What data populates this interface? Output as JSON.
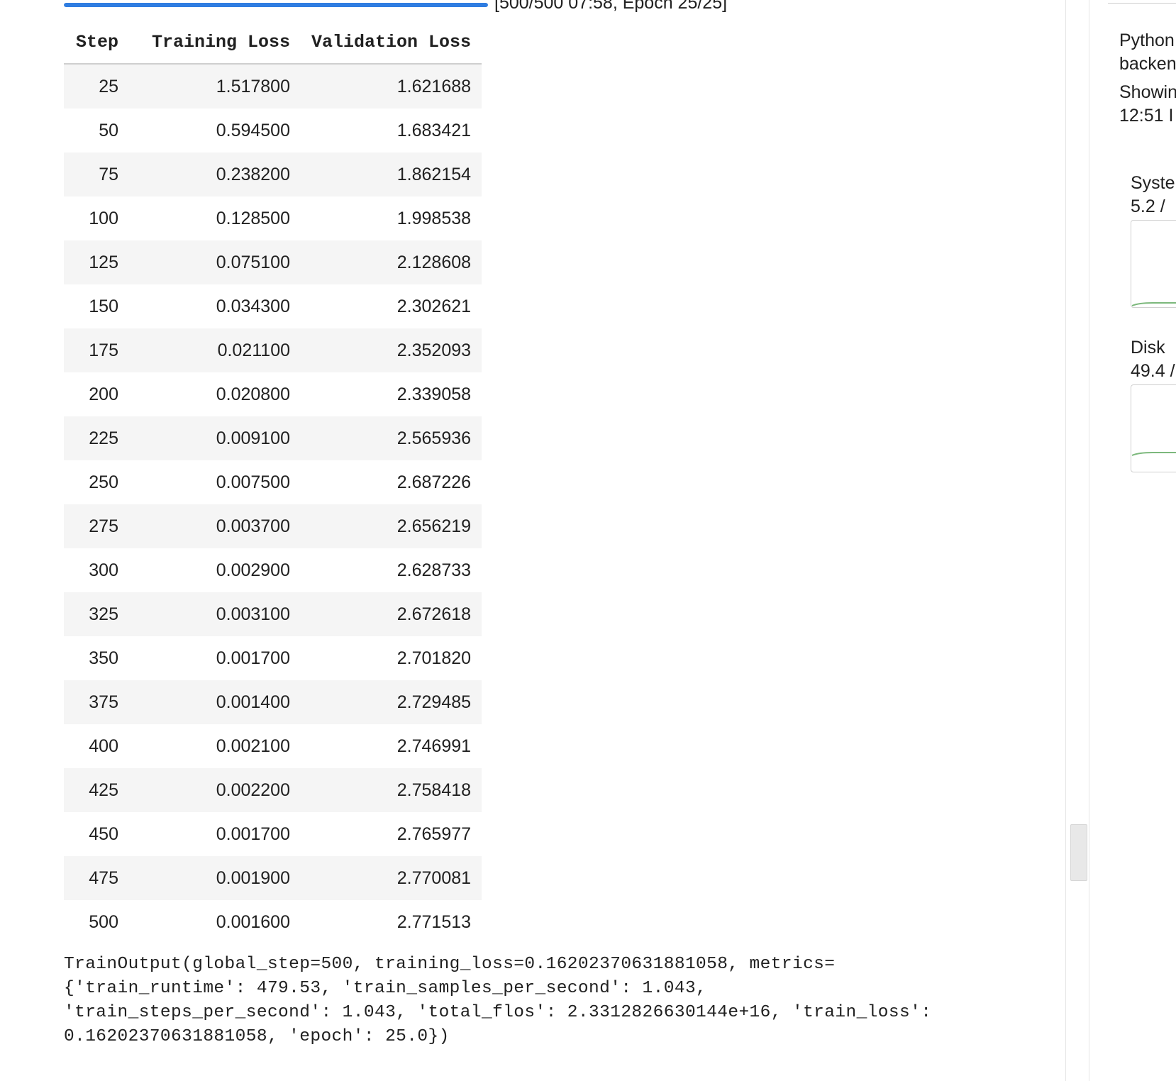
{
  "progress": {
    "fraction": 1.0,
    "label": "[500/500 07:58, Epoch 25/25]"
  },
  "table": {
    "columns": [
      "Step",
      "Training Loss",
      "Validation Loss"
    ],
    "rows": [
      [
        "25",
        "1.517800",
        "1.621688"
      ],
      [
        "50",
        "0.594500",
        "1.683421"
      ],
      [
        "75",
        "0.238200",
        "1.862154"
      ],
      [
        "100",
        "0.128500",
        "1.998538"
      ],
      [
        "125",
        "0.075100",
        "2.128608"
      ],
      [
        "150",
        "0.034300",
        "2.302621"
      ],
      [
        "175",
        "0.021100",
        "2.352093"
      ],
      [
        "200",
        "0.020800",
        "2.339058"
      ],
      [
        "225",
        "0.009100",
        "2.565936"
      ],
      [
        "250",
        "0.007500",
        "2.687226"
      ],
      [
        "275",
        "0.003700",
        "2.656219"
      ],
      [
        "300",
        "0.002900",
        "2.628733"
      ],
      [
        "325",
        "0.003100",
        "2.672618"
      ],
      [
        "350",
        "0.001700",
        "2.701820"
      ],
      [
        "375",
        "0.001400",
        "2.729485"
      ],
      [
        "400",
        "0.002100",
        "2.746991"
      ],
      [
        "425",
        "0.002200",
        "2.758418"
      ],
      [
        "450",
        "0.001700",
        "2.765977"
      ],
      [
        "475",
        "0.001900",
        "2.770081"
      ],
      [
        "500",
        "0.001600",
        "2.771513"
      ]
    ]
  },
  "train_output": "TrainOutput(global_step=500, training_loss=0.16202370631881058, metrics=\n{'train_runtime': 479.53, 'train_samples_per_second': 1.043,\n'train_steps_per_second': 1.043, 'total_flos': 2.3312826630144e+16, 'train_loss':\n0.16202370631881058, 'epoch': 25.0})",
  "side_panel": {
    "python_line1": "Python",
    "python_line2": "backen",
    "showing_line1": "Showin",
    "showing_line2": "12:51 I",
    "system_label": "Syste",
    "system_value": "5.2 /",
    "disk_label": "Disk",
    "disk_value": "49.4 /"
  },
  "colors": {
    "progress": "#2f7de1",
    "chart_line": "#7cb87c"
  }
}
